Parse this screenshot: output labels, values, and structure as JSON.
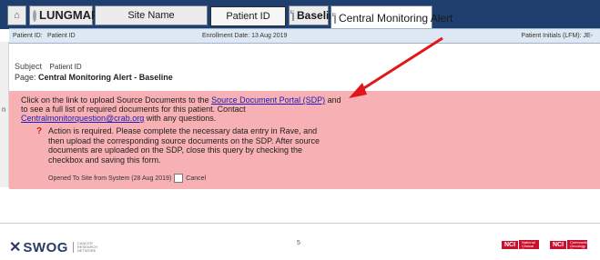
{
  "tabs": {
    "home_icon": "home-icon",
    "lungmap": "LUNGMAP",
    "site_name": "Site Name",
    "patient_id": "Patient ID",
    "baseline": "Baseline",
    "central_monitoring_alert": "Central Monitoring Alert"
  },
  "patient_strip": {
    "patient_id_label": "Patient ID:",
    "patient_id_value": "Patient ID",
    "enrollment_date": "Enrollment Date: 13 Aug 2019",
    "initials": "Patient Initials (LFM): JE-"
  },
  "left_edge": {
    "letter": "n"
  },
  "subject": {
    "label": "Subject",
    "value": "Patient ID",
    "page_label": "Page:",
    "page_value": "Central Monitoring Alert - Baseline"
  },
  "alert": {
    "intro_before_link": "Click on the link to upload Source Documents to the ",
    "link_text": "Source Document Portal (SDP)",
    "intro_after_link": " and to see a full list of required documents for this patient. Contact ",
    "email": "Centralmonitorquestion@crab.org",
    "intro_end": " with any questions.",
    "action_text": "Action is required. Please complete the necessary data entry in Rave, and then upload the corresponding source documents on the SDP. After source documents are uploaded on the SDP, close this query by checking the checkbox and saving this form.",
    "opened": "Opened To Site from System (28 Aug 2019)",
    "cancel": "Cancel"
  },
  "footer": {
    "swog": "SWOG",
    "swog_sub": [
      "CANCER",
      "RESEARCH",
      "NETWORK"
    ],
    "page_number": "5",
    "nci1_badge": "NCI",
    "nci1_text": "National Clinical Trials Network",
    "nci2_badge": "NCI",
    "nci2_text": "Community Oncology Research Program"
  },
  "colors": {
    "tabbar": "#1f3f6e",
    "alert_bg": "#f7b1b4",
    "arrow": "#e0161b",
    "link": "#1a1ab8"
  }
}
